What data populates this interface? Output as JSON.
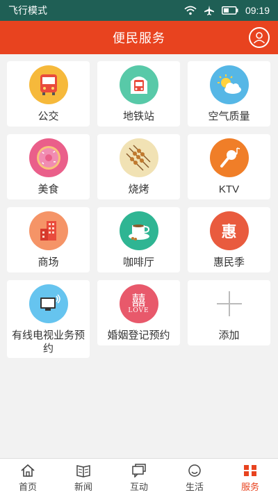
{
  "status_bar": {
    "mode": "飞行模式",
    "time": "09:19"
  },
  "header": {
    "title": "便民服务"
  },
  "tiles": [
    {
      "label": "公交",
      "icon": "bus-icon"
    },
    {
      "label": "地铁站",
      "icon": "subway-icon"
    },
    {
      "label": "空气质量",
      "icon": "weather-icon"
    },
    {
      "label": "美食",
      "icon": "donut-icon"
    },
    {
      "label": "烧烤",
      "icon": "barbecue-icon"
    },
    {
      "label": "KTV",
      "icon": "microphone-icon"
    },
    {
      "label": "商场",
      "icon": "mall-building-icon"
    },
    {
      "label": "咖啡厅",
      "icon": "coffee-icon"
    },
    {
      "label": "惠民季",
      "icon": "hui-badge-icon",
      "badge_text": "惠"
    },
    {
      "label": "有线电视业务预约",
      "icon": "tv-icon"
    },
    {
      "label": "婚姻登记预约",
      "icon": "wedding-icon",
      "badge_text": "囍",
      "badge_sub": "LOVE"
    },
    {
      "label": "添加",
      "icon": "plus-icon"
    }
  ],
  "bottom_nav": [
    {
      "label": "首页",
      "icon": "home-icon"
    },
    {
      "label": "新闻",
      "icon": "news-icon"
    },
    {
      "label": "互动",
      "icon": "chat-icon"
    },
    {
      "label": "生活",
      "icon": "life-icon"
    },
    {
      "label": "服务",
      "icon": "service-icon"
    }
  ]
}
